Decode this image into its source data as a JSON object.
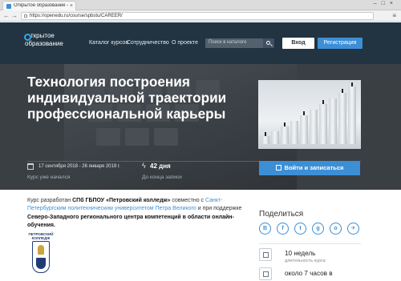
{
  "browser": {
    "tab_title": "Открытое образование - Тех",
    "url": "https://openedu.ru/course/spbstu/CAREER/"
  },
  "header": {
    "logo_line1": "ткрытое",
    "logo_line2": "образование",
    "nav": [
      "Каталог курсов",
      "Сотрудничество",
      "О проекте"
    ],
    "search_placeholder": "Поиск в каталоге",
    "login_label": "Вход",
    "register_label": "Регистрация"
  },
  "hero": {
    "title": "Технология построения индивидуальной траектории профессиональной карьеры",
    "dates": "17 сентября 2018 - 26 января 2019 г.",
    "started": "Курс уже начался",
    "days": "42 дня",
    "days_sub": "До конца записи",
    "enroll_label": "Войти и записаться"
  },
  "content": {
    "desc_p1": "Курс разработан ",
    "desc_b1": "СПб ГБПОУ «Петровский колледж»",
    "desc_p2": " совместно с ",
    "desc_link": "Санкт-Петербургским политехническим университетом Петра Великого",
    "desc_p3": " и при поддержке ",
    "desc_b2": "Северо-Западного регионального центра компетенций в области онлайн-обучения.",
    "college_logo_text": "ПЕТРОВСКИЙ КОЛЛЕДЖ"
  },
  "sidebar": {
    "share_title": "Поделиться",
    "social": [
      "В",
      "f",
      "t",
      "g",
      "о",
      "✈"
    ],
    "duration_value": "10 недель",
    "duration_label": "длительность курса",
    "workload_value": "около 7 часов в"
  },
  "colors": {
    "header_bg": "#223341",
    "accent": "#3d8fd5",
    "hero_bg": "#3a3f44"
  }
}
